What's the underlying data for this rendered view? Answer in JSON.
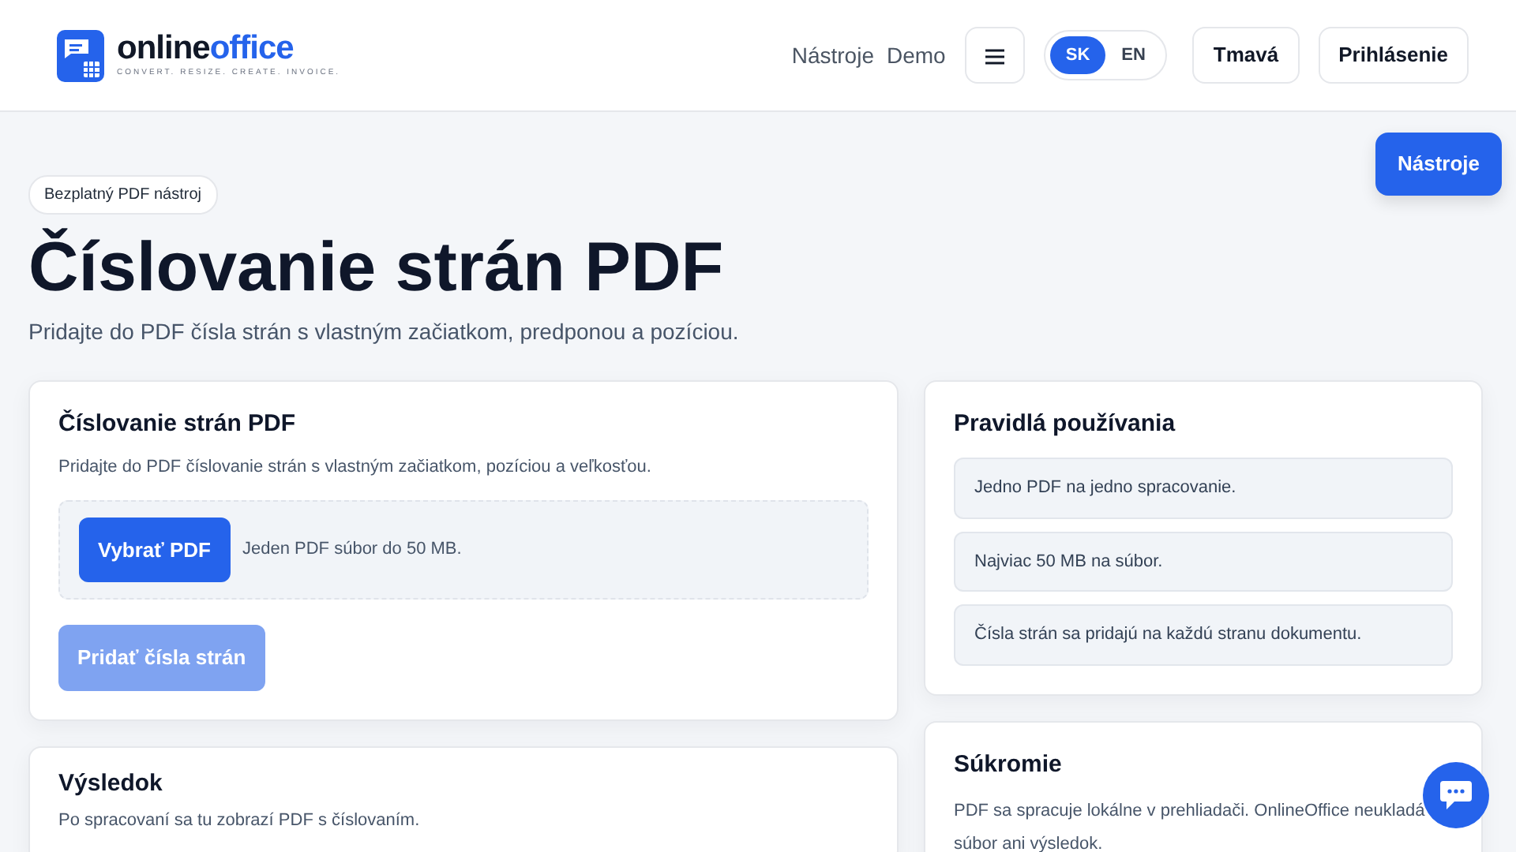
{
  "header": {
    "logo": {
      "name": "online",
      "accent": "office",
      "tagline": "CONVERT. RESIZE. CREATE. INVOICE."
    },
    "nav_links": [
      "Nástroje",
      "Demo"
    ],
    "languages": [
      {
        "label": "SK",
        "selected": true
      },
      {
        "label": "EN",
        "selected": false
      }
    ],
    "buttons": [
      "Tmavá",
      "Prihlásenie"
    ]
  },
  "floating_button": "Nástroje",
  "hero": {
    "badge": "Bezplatný PDF nástroj",
    "title": "Číslovanie strán PDF",
    "subtitle": "Pridajte do PDF čísla strán s vlastným začiatkom, predponou a pozíciou."
  },
  "tool_card": {
    "title": "Číslovanie strán PDF",
    "description": "Pridajte do PDF číslovanie strán s vlastným začiatkom, pozíciou a veľkosťou.",
    "upload_button": "Vybrať PDF",
    "upload_hint": "Jeden PDF súbor do 50 MB.",
    "submit": {
      "label": "Pridať čísla strán",
      "disabled": true
    }
  },
  "result_card": {
    "title": "Výsledok",
    "text": "Po spracovaní sa tu zobrazí PDF s číslovaním."
  },
  "rules_card": {
    "title": "Pravidlá používania",
    "items": [
      "Jedno PDF na jedno spracovanie.",
      "Najviac 50 MB na súbor.",
      "Čísla strán sa pridajú na každú stranu dokumentu."
    ]
  },
  "privacy_card": {
    "title": "Súkromie",
    "text": "PDF sa spracuje lokálne v prehliadači. OnlineOffice neukladá súbor ani výsledok."
  }
}
